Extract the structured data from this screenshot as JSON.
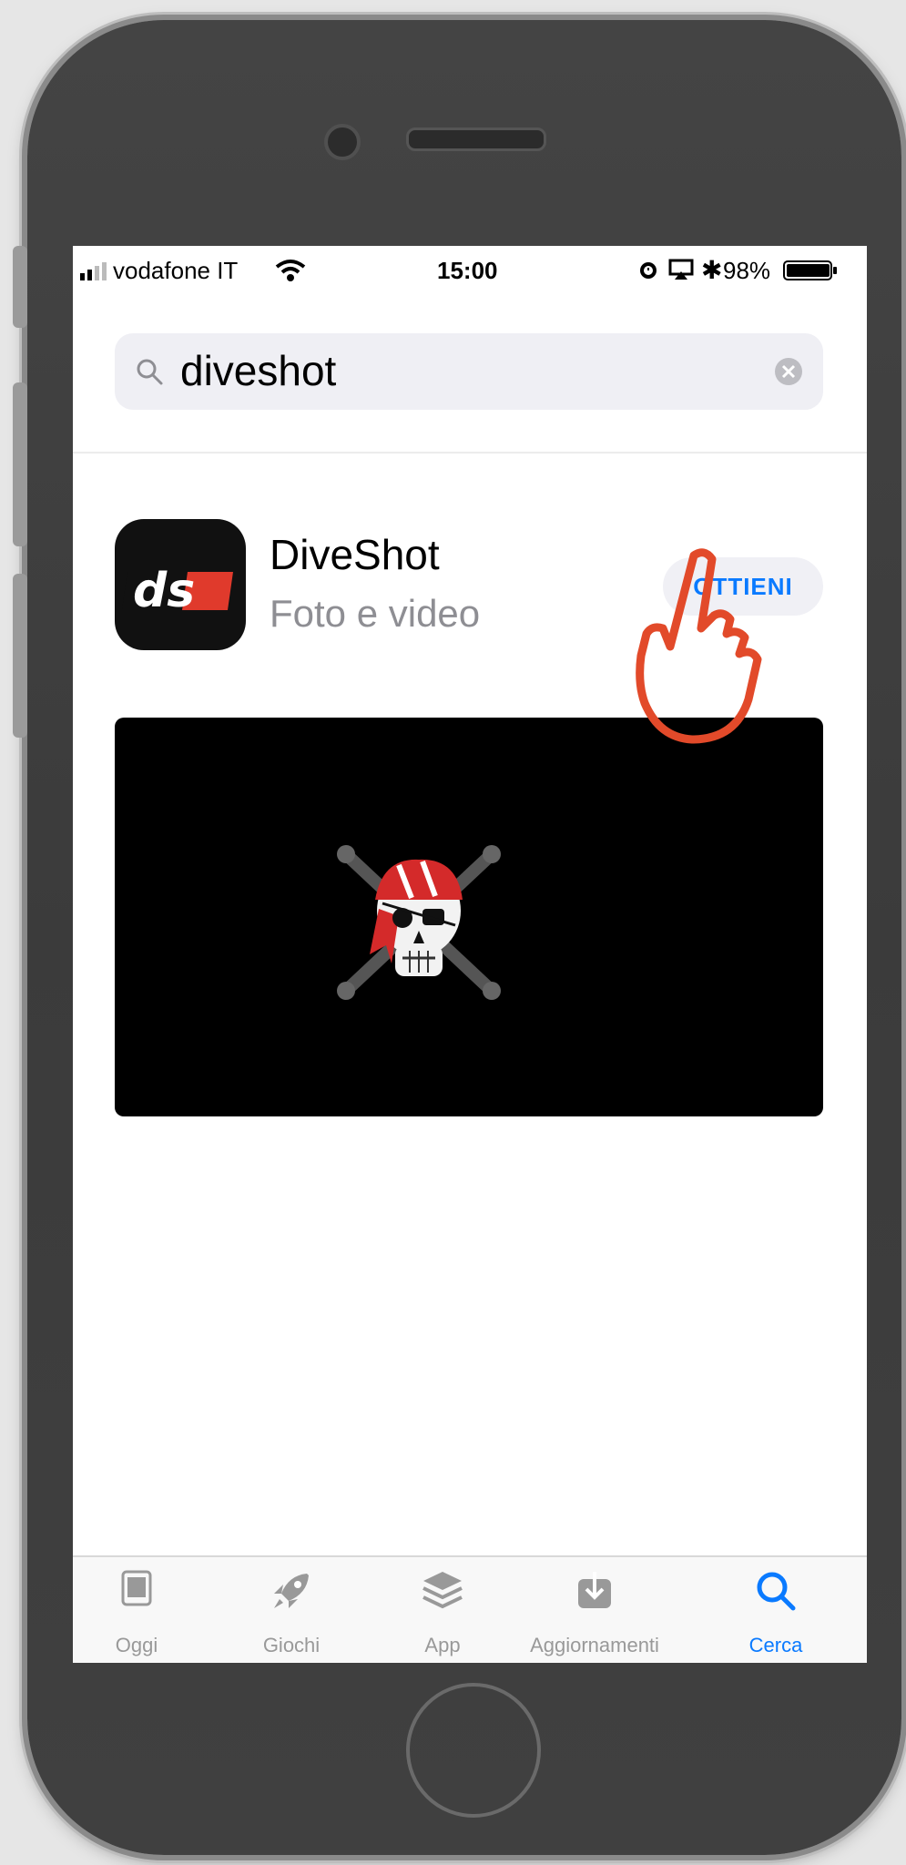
{
  "status_bar": {
    "carrier": "vodafone IT",
    "time": "15:00",
    "battery": "98%"
  },
  "search": {
    "query": "diveshot"
  },
  "result": {
    "app_name": "DiveShot",
    "category": "Foto e video",
    "icon_text": "ds",
    "get_label": "OTTIENI"
  },
  "tab_bar": {
    "tabs": [
      {
        "label": "Oggi",
        "icon": "today-icon"
      },
      {
        "label": "Giochi",
        "icon": "rocket-icon"
      },
      {
        "label": "App",
        "icon": "stack-icon"
      },
      {
        "label": "Aggiornamenti",
        "icon": "download-icon"
      },
      {
        "label": "Cerca",
        "icon": "search-icon"
      }
    ],
    "active": "Cerca"
  },
  "colors": {
    "accent": "#0a7aff",
    "inactive": "#999999",
    "brand_red": "#e03a2c"
  }
}
